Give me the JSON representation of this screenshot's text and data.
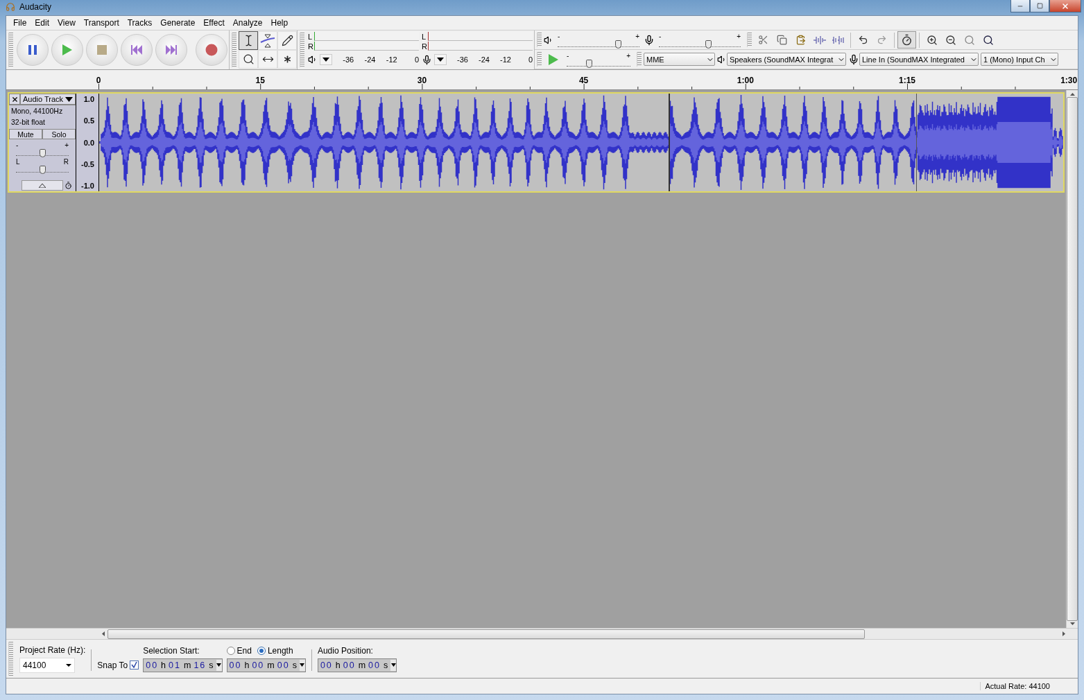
{
  "window": {
    "title": "Audacity"
  },
  "menu": [
    "File",
    "Edit",
    "View",
    "Transport",
    "Tracks",
    "Generate",
    "Effect",
    "Analyze",
    "Help"
  ],
  "transport": [
    {
      "kind": "pause"
    },
    {
      "kind": "play"
    },
    {
      "kind": "stop"
    },
    {
      "kind": "skip_start"
    },
    {
      "kind": "skip_end"
    },
    {
      "kind": "record"
    }
  ],
  "tools": [
    {
      "kind": "select",
      "selected": true
    },
    {
      "kind": "envelope",
      "selected": false
    },
    {
      "kind": "draw",
      "selected": false
    },
    {
      "kind": "zoom",
      "selected": false
    },
    {
      "kind": "timeshift",
      "selected": false
    },
    {
      "kind": "multi",
      "selected": false
    }
  ],
  "meters": [
    {
      "kind": "playback",
      "channels": [
        "L",
        "R"
      ],
      "ticks": [
        "-36",
        "-24",
        "-12",
        "0"
      ]
    },
    {
      "kind": "recording",
      "channels": [
        "L",
        "R"
      ],
      "ticks": [
        "-36",
        "-24",
        "-12",
        "0"
      ]
    }
  ],
  "mixer": {
    "playback_volume": {
      "min": "-",
      "max": "+",
      "level": 0.74
    },
    "recording_volume": {
      "min": "-",
      "max": "+",
      "level": 0.6
    }
  },
  "play_at_speed": {
    "min": "-",
    "max": "+",
    "level": 0.35
  },
  "device": {
    "host": "MME",
    "output": "Speakers (SoundMAX Integrat",
    "input": "Line In (SoundMAX Integrated",
    "channels": "1 (Mono) Input Ch"
  },
  "timeline": {
    "ticks": [
      "0",
      "15",
      "30",
      "45",
      "1:00",
      "1:15",
      "1:30"
    ]
  },
  "track": {
    "name": "Audio Track",
    "info": [
      "Mono, 44100Hz",
      "32-bit float"
    ],
    "mute": "Mute",
    "solo": "Solo",
    "selected": true,
    "gain": {
      "min": "-",
      "max": "+",
      "level": 0.5
    },
    "pan": {
      "min": "L",
      "max": "R",
      "level": 0.5
    },
    "scale": [
      "1.0",
      "0.5",
      "0.0",
      "-0.5",
      "-1.0"
    ]
  },
  "selection_toolbar": {
    "project_rate_label": "Project Rate (Hz):",
    "project_rate": "44100",
    "snap_to": {
      "label": "Snap To",
      "checked": true
    },
    "selection_start_label": "Selection Start:",
    "selection_start": "00 h 01 m 16 s",
    "end": {
      "label": "End",
      "selected": false
    },
    "length": {
      "label": "Length",
      "selected": true
    },
    "selection_length": "00 h 00 m 00 s",
    "audio_position_label": "Audio Position:",
    "audio_position": "00 h 00 m 00 s"
  },
  "status_bar": {
    "actual_rate": "Actual Rate: 44100"
  }
}
